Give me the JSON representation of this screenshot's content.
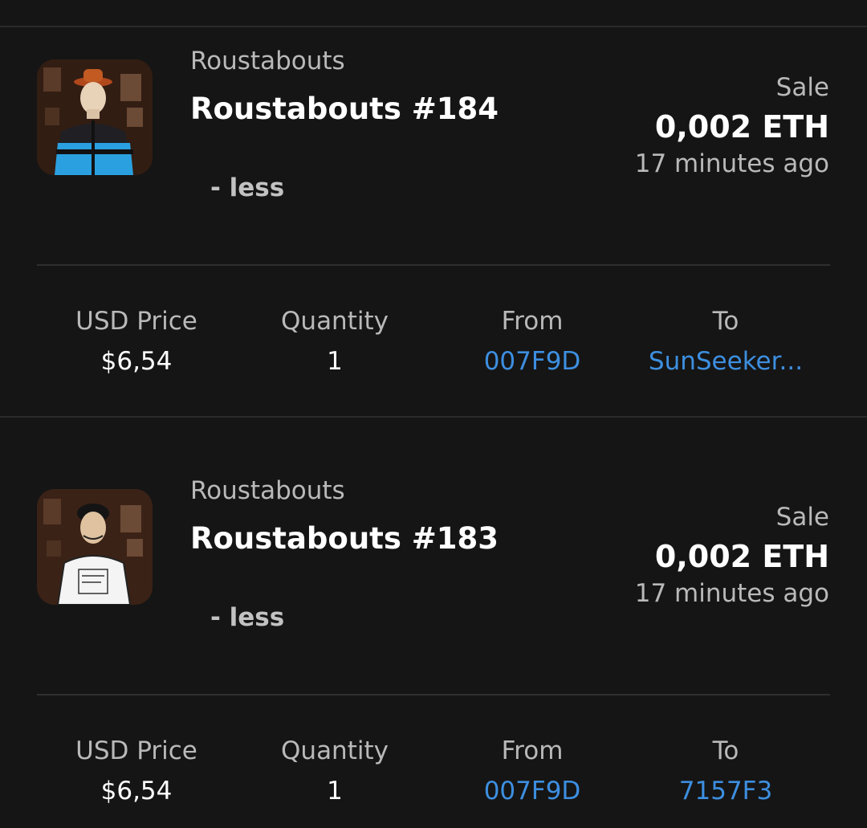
{
  "activities": [
    {
      "collection": "Roustabouts",
      "title": "Roustabouts #184",
      "toggle": "- less",
      "event_type": "Sale",
      "price": "0,002 ETH",
      "time_ago": "17 minutes ago",
      "stats": [
        {
          "label": "USD Price",
          "value": "$6,54"
        },
        {
          "label": "Quantity",
          "value": "1"
        },
        {
          "label": "From",
          "value": "007F9D"
        },
        {
          "label": "To",
          "value": "SunSeeker..."
        }
      ]
    },
    {
      "collection": "Roustabouts",
      "title": "Roustabouts #183",
      "toggle": "- less",
      "event_type": "Sale",
      "price": "0,002 ETH",
      "time_ago": "17 minutes ago",
      "stats": [
        {
          "label": "USD Price",
          "value": "$6,54"
        },
        {
          "label": "Quantity",
          "value": "1"
        },
        {
          "label": "From",
          "value": "007F9D"
        },
        {
          "label": "To",
          "value": "7157F3"
        }
      ]
    }
  ],
  "colors": {
    "background": "#151515",
    "link": "#3d8fe0",
    "text_primary": "#ffffff",
    "text_secondary": "#b9b9b9"
  }
}
